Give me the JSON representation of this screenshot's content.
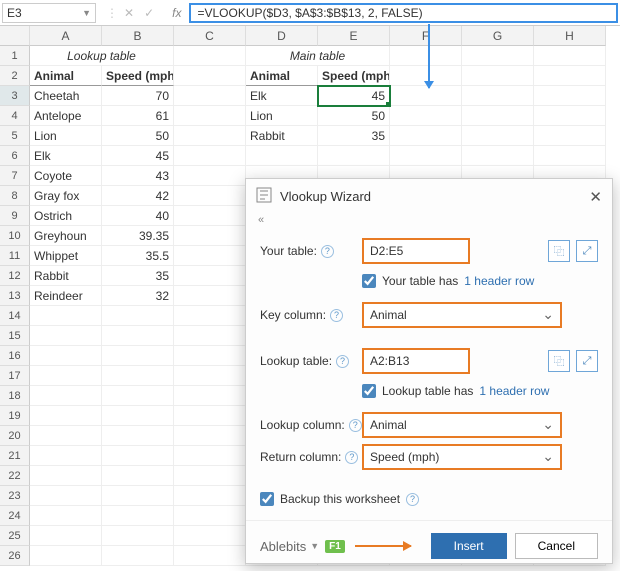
{
  "name_box": "E3",
  "formula": "=VLOOKUP($D3, $A$3:$B$13, 2, FALSE)",
  "columns": [
    "A",
    "B",
    "C",
    "D",
    "E",
    "F",
    "G",
    "H"
  ],
  "rows": [
    1,
    2,
    3,
    4,
    5,
    6,
    7,
    8,
    9,
    10,
    11,
    12,
    13,
    14,
    15,
    16,
    17,
    18,
    19,
    20,
    21,
    22,
    23,
    24,
    25,
    26
  ],
  "lookup": {
    "title": "Lookup table",
    "headers": [
      "Animal",
      "Speed (mph)"
    ],
    "data": [
      [
        "Cheetah",
        "70"
      ],
      [
        "Antelope",
        "61"
      ],
      [
        "Lion",
        "50"
      ],
      [
        "Elk",
        "45"
      ],
      [
        "Coyote",
        "43"
      ],
      [
        "Gray fox",
        "42"
      ],
      [
        "Ostrich",
        "40"
      ],
      [
        "Greyhoun",
        "39.35"
      ],
      [
        "Whippet",
        "35.5"
      ],
      [
        "Rabbit",
        "35"
      ],
      [
        "Reindeer",
        "32"
      ]
    ]
  },
  "main": {
    "title": "Main table",
    "headers": [
      "Animal",
      "Speed (mph)"
    ],
    "data": [
      [
        "Elk",
        "45"
      ],
      [
        "Lion",
        "50"
      ],
      [
        "Rabbit",
        "35"
      ]
    ]
  },
  "wizard": {
    "title": "Vlookup Wizard",
    "labels": {
      "your_table": "Your table:",
      "key_column": "Key column:",
      "lookup_table": "Lookup table:",
      "lookup_column": "Lookup column:",
      "return_column": "Return column:"
    },
    "values": {
      "your_table": "D2:E5",
      "key_column": "Animal",
      "lookup_table": "A2:B13",
      "lookup_column": "Animal",
      "return_column": "Speed (mph)"
    },
    "checks": {
      "your_has": "Your table has",
      "your_rows": "1 header row",
      "lookup_has": "Lookup table has",
      "lookup_rows": "1 header row",
      "backup": "Backup this worksheet"
    },
    "brand": "Ablebits",
    "f1": "F1",
    "insert": "Insert",
    "cancel": "Cancel"
  }
}
